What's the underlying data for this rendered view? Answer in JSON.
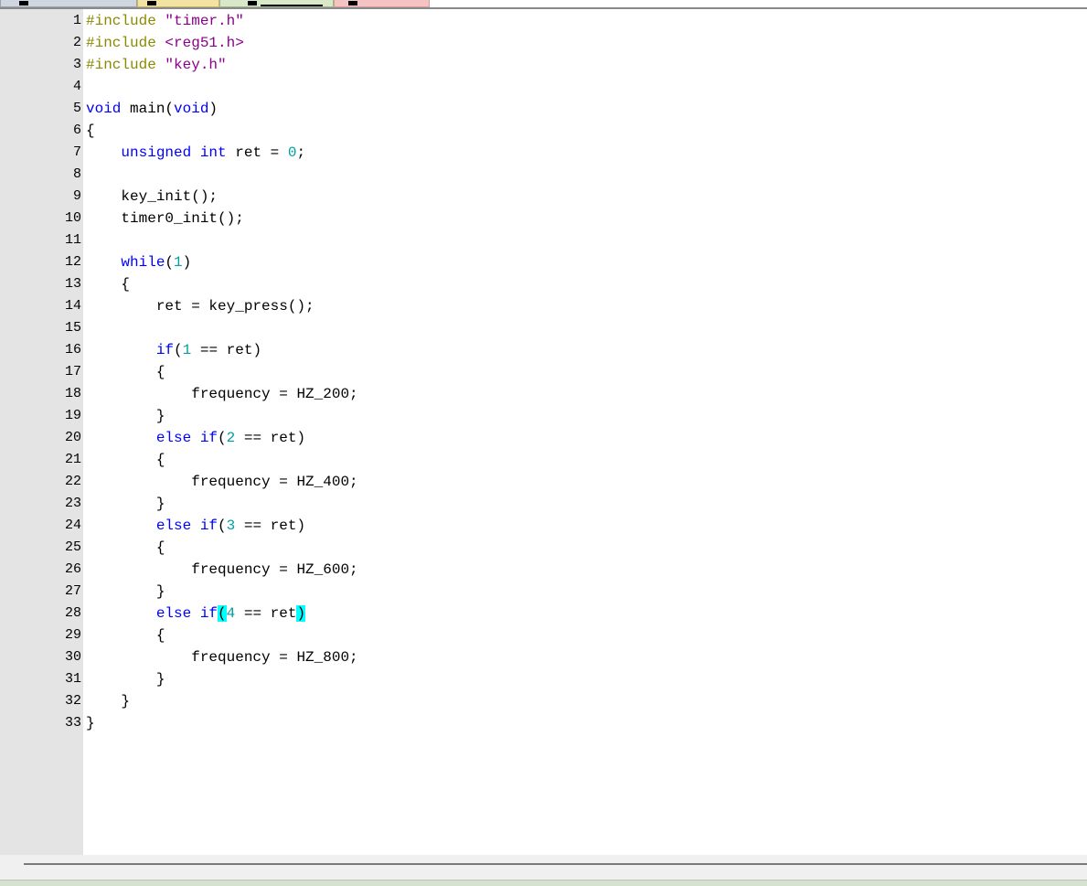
{
  "editor": {
    "lines": [
      {
        "n": "1",
        "tokens": [
          {
            "t": "#include ",
            "c": "pp"
          },
          {
            "t": "\"timer.h\"",
            "c": "str"
          }
        ]
      },
      {
        "n": "2",
        "tokens": [
          {
            "t": "#include ",
            "c": "pp"
          },
          {
            "t": "<reg51.h>",
            "c": "str"
          }
        ]
      },
      {
        "n": "3",
        "tokens": [
          {
            "t": "#include ",
            "c": "pp"
          },
          {
            "t": "\"key.h\"",
            "c": "str"
          }
        ]
      },
      {
        "n": "4",
        "tokens": []
      },
      {
        "n": "5",
        "tokens": [
          {
            "t": "void",
            "c": "kw"
          },
          {
            "t": " main("
          },
          {
            "t": "void",
            "c": "kw"
          },
          {
            "t": ")"
          }
        ]
      },
      {
        "n": "6",
        "tokens": [
          {
            "t": "{"
          }
        ]
      },
      {
        "n": "7",
        "tokens": [
          {
            "t": "    "
          },
          {
            "t": "unsigned",
            "c": "kw"
          },
          {
            "t": " "
          },
          {
            "t": "int",
            "c": "kw"
          },
          {
            "t": " ret = "
          },
          {
            "t": "0",
            "c": "num"
          },
          {
            "t": ";"
          }
        ]
      },
      {
        "n": "8",
        "tokens": []
      },
      {
        "n": "9",
        "tokens": [
          {
            "t": "    key_init();"
          }
        ]
      },
      {
        "n": "10",
        "tokens": [
          {
            "t": "    timer0_init();"
          }
        ]
      },
      {
        "n": "11",
        "tokens": []
      },
      {
        "n": "12",
        "tokens": [
          {
            "t": "    "
          },
          {
            "t": "while",
            "c": "kw"
          },
          {
            "t": "("
          },
          {
            "t": "1",
            "c": "num"
          },
          {
            "t": ")"
          }
        ]
      },
      {
        "n": "13",
        "tokens": [
          {
            "t": "    {"
          }
        ]
      },
      {
        "n": "14",
        "tokens": [
          {
            "t": "        ret = key_press();"
          }
        ]
      },
      {
        "n": "15",
        "tokens": []
      },
      {
        "n": "16",
        "tokens": [
          {
            "t": "        "
          },
          {
            "t": "if",
            "c": "kw"
          },
          {
            "t": "("
          },
          {
            "t": "1",
            "c": "num"
          },
          {
            "t": " == ret)"
          }
        ]
      },
      {
        "n": "17",
        "tokens": [
          {
            "t": "        {"
          }
        ]
      },
      {
        "n": "18",
        "tokens": [
          {
            "t": "            frequency = HZ_200;"
          }
        ]
      },
      {
        "n": "19",
        "tokens": [
          {
            "t": "        }"
          }
        ]
      },
      {
        "n": "20",
        "tokens": [
          {
            "t": "        "
          },
          {
            "t": "else",
            "c": "kw"
          },
          {
            "t": " "
          },
          {
            "t": "if",
            "c": "kw"
          },
          {
            "t": "("
          },
          {
            "t": "2",
            "c": "num"
          },
          {
            "t": " == ret)"
          }
        ]
      },
      {
        "n": "21",
        "tokens": [
          {
            "t": "        {"
          }
        ]
      },
      {
        "n": "22",
        "tokens": [
          {
            "t": "            frequency = HZ_400;"
          }
        ]
      },
      {
        "n": "23",
        "tokens": [
          {
            "t": "        }"
          }
        ]
      },
      {
        "n": "24",
        "tokens": [
          {
            "t": "        "
          },
          {
            "t": "else",
            "c": "kw"
          },
          {
            "t": " "
          },
          {
            "t": "if",
            "c": "kw"
          },
          {
            "t": "("
          },
          {
            "t": "3",
            "c": "num"
          },
          {
            "t": " == ret)"
          }
        ]
      },
      {
        "n": "25",
        "tokens": [
          {
            "t": "        {"
          }
        ]
      },
      {
        "n": "26",
        "tokens": [
          {
            "t": "            frequency = HZ_600;"
          }
        ]
      },
      {
        "n": "27",
        "tokens": [
          {
            "t": "        }"
          }
        ]
      },
      {
        "n": "28",
        "tokens": [
          {
            "t": "        "
          },
          {
            "t": "else",
            "c": "kw"
          },
          {
            "t": " "
          },
          {
            "t": "if",
            "c": "kw"
          },
          {
            "t": "(",
            "c": "hl"
          },
          {
            "t": "4",
            "c": "num"
          },
          {
            "t": " == ret"
          },
          {
            "t": ")",
            "c": "hl"
          }
        ]
      },
      {
        "n": "29",
        "tokens": [
          {
            "t": "        {"
          }
        ]
      },
      {
        "n": "30",
        "tokens": [
          {
            "t": "            frequency = HZ_800;"
          }
        ]
      },
      {
        "n": "31",
        "tokens": [
          {
            "t": "        }"
          }
        ]
      },
      {
        "n": "32",
        "tokens": [
          {
            "t": "    }"
          }
        ]
      },
      {
        "n": "33",
        "tokens": [
          {
            "t": "}"
          }
        ]
      }
    ],
    "colors": {
      "preprocessor": "#8a8a00",
      "string": "#8b008b",
      "keyword": "#0000ff",
      "number": "#00a0a0",
      "brace_match_highlight": "#00ffff",
      "gutter_background": "#e4e4e4"
    }
  }
}
